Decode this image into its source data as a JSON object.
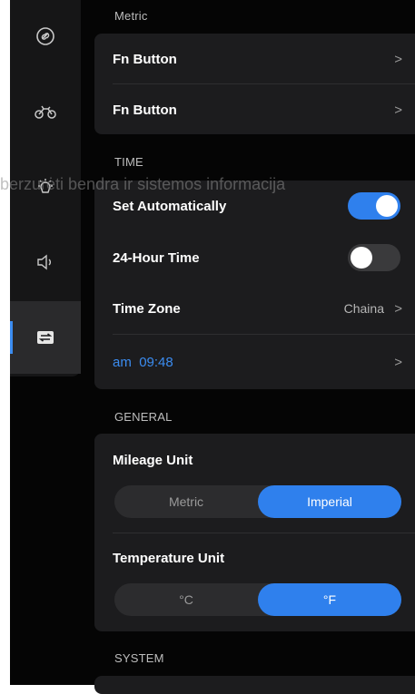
{
  "sidebar": {
    "items": [
      {
        "icon": "link-icon"
      },
      {
        "icon": "motorcycle-icon"
      },
      {
        "icon": "brightness-icon"
      },
      {
        "icon": "volume-icon"
      },
      {
        "icon": "swap-icon",
        "active": true
      }
    ]
  },
  "metric_section": {
    "label": "Metric",
    "rows": [
      {
        "label": "Fn Button",
        "chevron": ">"
      },
      {
        "label": "Fn Button",
        "chevron": ">"
      }
    ]
  },
  "time_section": {
    "label": "TIME",
    "set_automatically": {
      "label": "Set Automatically",
      "enabled": true
    },
    "hour24": {
      "label": "24-Hour Time",
      "enabled": false
    },
    "time_zone": {
      "label": "Time Zone",
      "value": "Chaina",
      "chevron": ">"
    },
    "clock": {
      "period": "am",
      "time": "09:48",
      "chevron": ">"
    }
  },
  "general_section": {
    "label": "GENERAL",
    "mileage": {
      "label": "Mileage Unit",
      "options": [
        "Metric",
        "Imperial"
      ],
      "selected": "Imperial"
    },
    "temperature": {
      "label": "Temperature Unit",
      "options": [
        "°C",
        "°F"
      ],
      "selected": "°F"
    }
  },
  "system_section": {
    "label": "SYSTEM"
  },
  "overlay_text": "berzurėti bendra ir sistemos informacija",
  "colors": {
    "accent": "#2f80ed",
    "background": "#050505",
    "card": "#1c1c1e",
    "sidebar": "#161617"
  }
}
